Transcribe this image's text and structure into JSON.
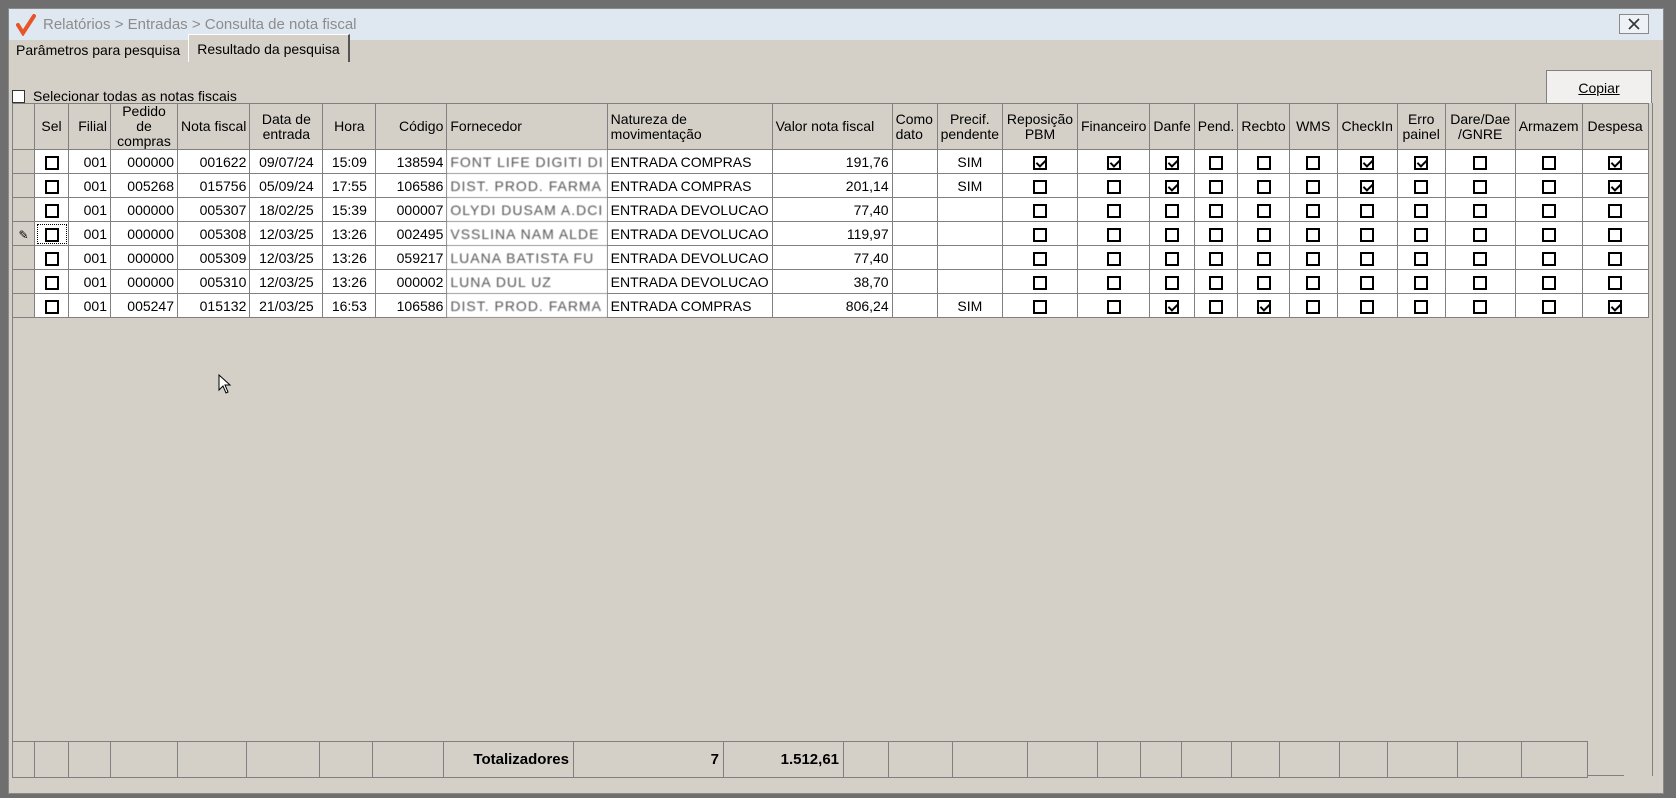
{
  "window": {
    "title": "Relatórios > Entradas > Consulta de nota fiscal",
    "close_icon": "close-icon"
  },
  "tabs": [
    {
      "label": "Parâmetros para pesquisa",
      "active": false
    },
    {
      "label": "Resultado da pesquisa",
      "active": true
    }
  ],
  "select_all_label": "Selecionar todas as notas fiscais",
  "copy_button": "Copiar",
  "columns": {
    "sel": "Sel",
    "filial": "Filial",
    "pedido": "Pedido de compras",
    "nota": "Nota fiscal",
    "data": "Data de entrada",
    "hora": "Hora",
    "codigo": "Código",
    "fornecedor": "Fornecedor",
    "natureza": "Natureza de movimentação",
    "valor": "Valor nota fiscal",
    "como_dato": "Como dato",
    "precif": "Precif. pendente",
    "reposicao": "Reposição PBM",
    "financeiro": "Financeiro",
    "danfe": "Danfe",
    "pend": "Pend.",
    "recbto": "Recbto",
    "wms": "WMS",
    "checkin": "CheckIn",
    "erro": "Erro painel",
    "dare": "Dare/Dae /GNRE",
    "armazem": "Armazem",
    "despesa": "Despesa"
  },
  "rows": [
    {
      "filial": "001",
      "pedido": "000000",
      "nota": "001622",
      "data": "09/07/24",
      "hora": "15:09",
      "codigo": "138594",
      "fornecedor": "FONT LIFE DIGITI DI",
      "natureza": "ENTRADA COMPRAS",
      "valor": "191,76",
      "como_dato": "",
      "precif": "SIM",
      "sel": false,
      "reposicao": true,
      "financeiro": true,
      "danfe": true,
      "pend": false,
      "recbto": false,
      "wms": false,
      "checkin": true,
      "erro": true,
      "dare": false,
      "armazem": false,
      "despesa": true,
      "editing": false
    },
    {
      "filial": "001",
      "pedido": "005268",
      "nota": "015756",
      "data": "05/09/24",
      "hora": "17:55",
      "codigo": "106586",
      "fornecedor": "DIST. PROD. FARMA",
      "natureza": "ENTRADA COMPRAS",
      "valor": "201,14",
      "como_dato": "",
      "precif": "SIM",
      "sel": false,
      "reposicao": false,
      "financeiro": false,
      "danfe": true,
      "pend": false,
      "recbto": false,
      "wms": false,
      "checkin": true,
      "erro": false,
      "dare": false,
      "armazem": false,
      "despesa": true,
      "editing": false
    },
    {
      "filial": "001",
      "pedido": "000000",
      "nota": "005307",
      "data": "18/02/25",
      "hora": "15:39",
      "codigo": "000007",
      "fornecedor": "OLYDI DUSAM A.DCI",
      "natureza": "ENTRADA DEVOLUCAO",
      "valor": "77,40",
      "como_dato": "",
      "precif": "",
      "sel": false,
      "reposicao": false,
      "financeiro": false,
      "danfe": false,
      "pend": false,
      "recbto": false,
      "wms": false,
      "checkin": false,
      "erro": false,
      "dare": false,
      "armazem": false,
      "despesa": false,
      "editing": false
    },
    {
      "filial": "001",
      "pedido": "000000",
      "nota": "005308",
      "data": "12/03/25",
      "hora": "13:26",
      "codigo": "002495",
      "fornecedor": "VSSLINA NAM ALDE",
      "natureza": "ENTRADA DEVOLUCAO",
      "valor": "119,97",
      "como_dato": "",
      "precif": "",
      "sel": false,
      "reposicao": false,
      "financeiro": false,
      "danfe": false,
      "pend": false,
      "recbto": false,
      "wms": false,
      "checkin": false,
      "erro": false,
      "dare": false,
      "armazem": false,
      "despesa": false,
      "editing": true
    },
    {
      "filial": "001",
      "pedido": "000000",
      "nota": "005309",
      "data": "12/03/25",
      "hora": "13:26",
      "codigo": "059217",
      "fornecedor": "LUANA BATISTA FU",
      "natureza": "ENTRADA DEVOLUCAO",
      "valor": "77,40",
      "como_dato": "",
      "precif": "",
      "sel": false,
      "reposicao": false,
      "financeiro": false,
      "danfe": false,
      "pend": false,
      "recbto": false,
      "wms": false,
      "checkin": false,
      "erro": false,
      "dare": false,
      "armazem": false,
      "despesa": false,
      "editing": false
    },
    {
      "filial": "001",
      "pedido": "000000",
      "nota": "005310",
      "data": "12/03/25",
      "hora": "13:26",
      "codigo": "000002",
      "fornecedor": "LUNA DUL UZ",
      "natureza": "ENTRADA DEVOLUCAO",
      "valor": "38,70",
      "como_dato": "",
      "precif": "",
      "sel": false,
      "reposicao": false,
      "financeiro": false,
      "danfe": false,
      "pend": false,
      "recbto": false,
      "wms": false,
      "checkin": false,
      "erro": false,
      "dare": false,
      "armazem": false,
      "despesa": false,
      "editing": false
    },
    {
      "filial": "001",
      "pedido": "005247",
      "nota": "015132",
      "data": "21/03/25",
      "hora": "16:53",
      "codigo": "106586",
      "fornecedor": "DIST. PROD. FARMA",
      "natureza": "ENTRADA COMPRAS",
      "valor": "806,24",
      "como_dato": "",
      "precif": "SIM",
      "sel": false,
      "reposicao": false,
      "financeiro": false,
      "danfe": true,
      "pend": false,
      "recbto": true,
      "wms": false,
      "checkin": false,
      "erro": false,
      "dare": false,
      "armazem": false,
      "despesa": true,
      "editing": false
    }
  ],
  "totals": {
    "label": "Totalizadores",
    "count": "7",
    "sum": "1.512,61"
  }
}
